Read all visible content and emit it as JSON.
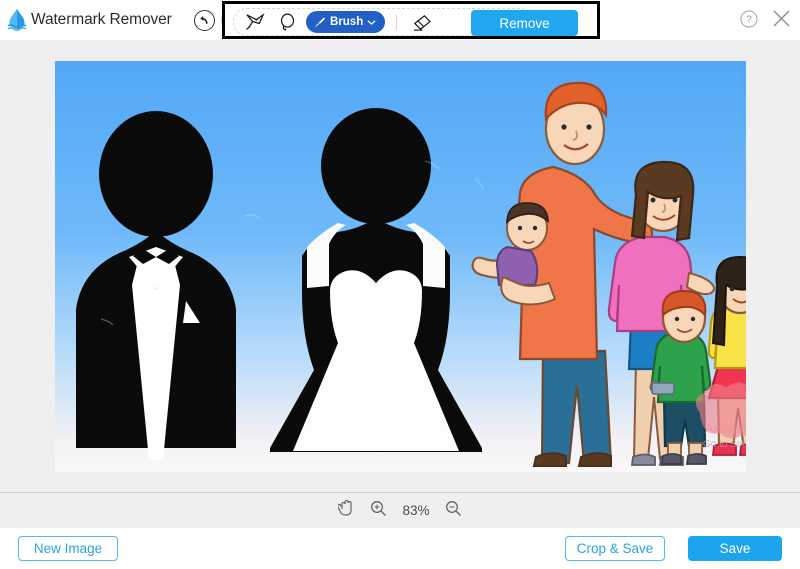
{
  "app": {
    "title": "Watermark Remover",
    "logo_icon": "water-drop-logo"
  },
  "header": {
    "undo_icon": "undo-arrow-icon",
    "redo_icon": "redo-arrow-icon",
    "help_icon": "help-circle-icon",
    "close_icon": "close-icon"
  },
  "toolbar": {
    "polygon_tool_icon": "polygon-lasso-icon",
    "freehand_tool_icon": "freehand-lasso-icon",
    "brush_label": "Brush",
    "brush_icon": "paintbrush-icon",
    "brush_chevron_icon": "chevron-down-icon",
    "eraser_icon": "eraser-icon",
    "remove_label": "Remove",
    "highlight_color": "#000000",
    "brush_button_color": "#2360c4",
    "remove_button_color": "#21a7ef"
  },
  "zoombar": {
    "pan_icon": "hand-pan-icon",
    "zoom_in_icon": "zoom-in-icon",
    "zoom_level": "83%",
    "zoom_out_icon": "zoom-out-icon"
  },
  "footer": {
    "new_image_label": "New Image",
    "crop_save_label": "Crop & Save",
    "save_label": "Save",
    "accent_color": "#1ca5ec",
    "outline_color": "#53b9ef"
  },
  "canvas": {
    "description": "Wedding couple silhouettes beside a cartoon family illustration on a blue sky background",
    "mask_overlay_label": "brush-mask-selection",
    "mask_color": "#f0808e",
    "watermark_text_line1": "Activate",
    "watermark_text_line2": "Go to Settings"
  }
}
